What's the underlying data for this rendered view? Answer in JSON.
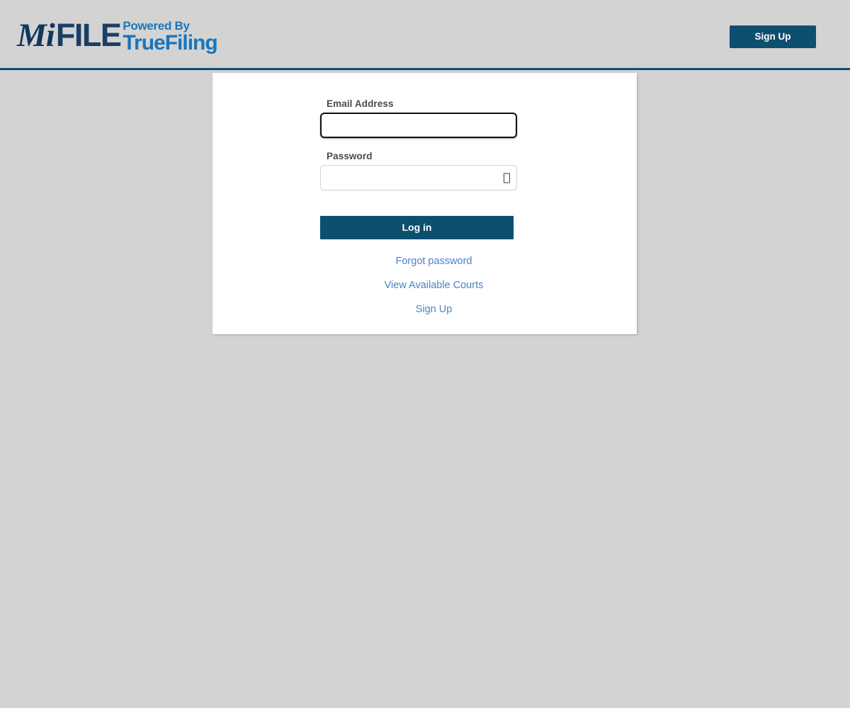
{
  "header": {
    "brand": {
      "mi": "Mi",
      "file": "FILE",
      "powered_by": "Powered By",
      "product": "TrueFiling"
    },
    "signup_button": "Sign Up",
    "accent_color": "#0c4f6e",
    "brand_blue": "#1b75bb",
    "brand_navy": "#1a3f66",
    "background": "#d3d3d3"
  },
  "login": {
    "email": {
      "label": "Email Address",
      "value": "",
      "placeholder": ""
    },
    "password": {
      "label": "Password",
      "value": "",
      "placeholder": "",
      "toggle_icon": "eye-icon-missing-glyph"
    },
    "submit_button": "Log in",
    "links": [
      {
        "label": "Forgot password",
        "name": "forgot-password-link"
      },
      {
        "label": "View Available Courts",
        "name": "view-available-courts-link"
      },
      {
        "label": "Sign Up",
        "name": "signup-link"
      }
    ],
    "link_color": "#4a83c4",
    "button_color": "#0c4f6e"
  }
}
